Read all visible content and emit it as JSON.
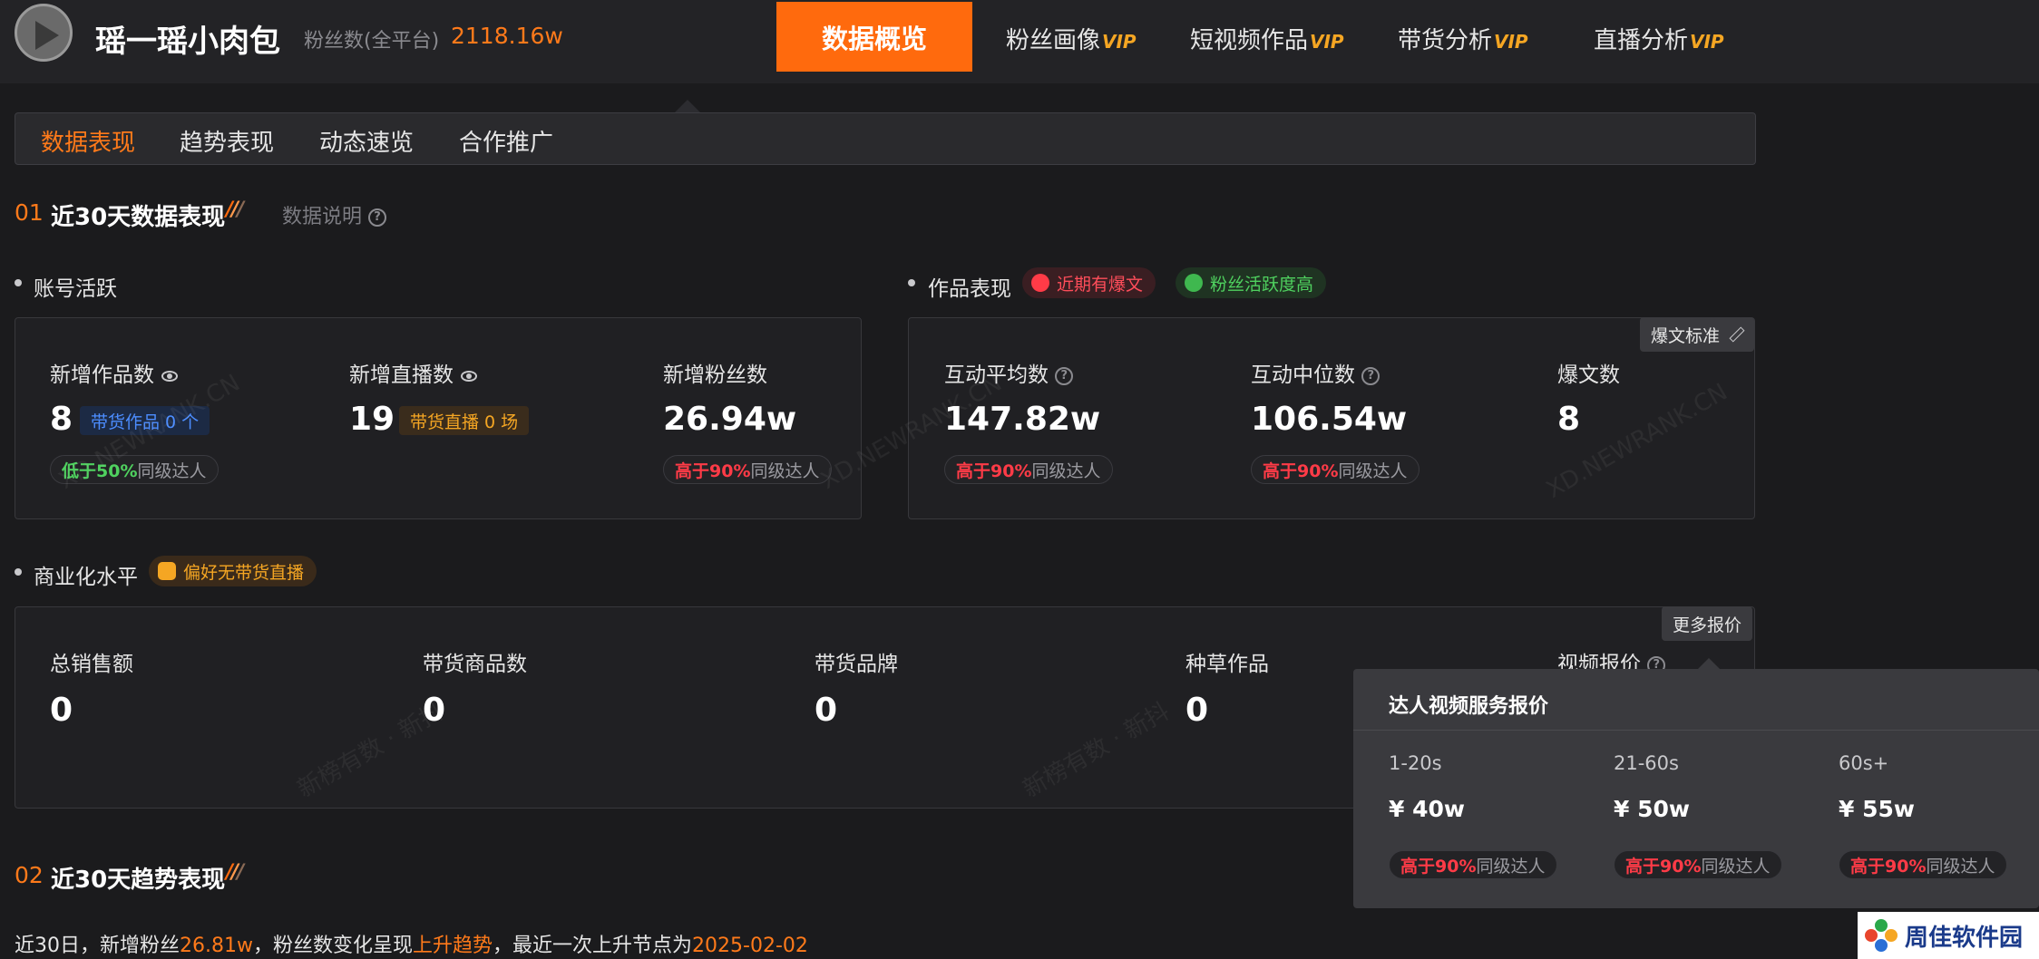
{
  "header": {
    "creator_name": "瑶一瑶小肉包",
    "fans_label": "粉丝数(全平台)",
    "fans_value": "2118.16w",
    "nav": {
      "active": "数据概览",
      "items": [
        {
          "label": "粉丝画像",
          "badge": "VIP"
        },
        {
          "label": "短视频作品",
          "badge": "VIP"
        },
        {
          "label": "带货分析",
          "badge": "VIP"
        },
        {
          "label": "直播分析",
          "badge": "VIP"
        }
      ]
    }
  },
  "subtabs": [
    "数据表现",
    "趋势表现",
    "动态速览",
    "合作推广"
  ],
  "section1": {
    "num": "01",
    "title": "近30天数据表现",
    "note": "数据说明",
    "account": {
      "title": "账号活跃",
      "metrics": [
        {
          "label": "新增作品数",
          "value": "8",
          "pill": "带货作品 0 个",
          "compare_prefix": "低于50%",
          "compare_suffix": "同级达人"
        },
        {
          "label": "新增直播数",
          "value": "19",
          "pill": "带货直播 0 场"
        },
        {
          "label": "新增粉丝数",
          "value": "26.94w",
          "compare_prefix": "高于90%",
          "compare_suffix": "同级达人"
        }
      ]
    },
    "works": {
      "title": "作品表现",
      "tag_hot": "近期有爆文",
      "tag_active": "粉丝活跃度高",
      "corner_btn": "爆文标准",
      "metrics": [
        {
          "label": "互动平均数",
          "value": "147.82w",
          "compare_prefix": "高于90%",
          "compare_suffix": "同级达人"
        },
        {
          "label": "互动中位数",
          "value": "106.54w",
          "compare_prefix": "高于90%",
          "compare_suffix": "同级达人"
        },
        {
          "label": "爆文数",
          "value": "8"
        }
      ]
    },
    "commerce": {
      "title": "商业化水平",
      "tag": "偏好无带货直播",
      "corner_btn": "更多报价",
      "metrics": [
        {
          "label": "总销售额",
          "value": "0"
        },
        {
          "label": "带货商品数",
          "value": "0"
        },
        {
          "label": "带货品牌",
          "value": "0"
        },
        {
          "label": "种草作品",
          "value": "0"
        },
        {
          "label": "视频报价"
        }
      ]
    }
  },
  "popup": {
    "title": "达人视频服务报价",
    "prices": [
      {
        "range": "1-20s",
        "value": "¥ 40w",
        "compare_prefix": "高于90%",
        "compare_suffix": "同级达人"
      },
      {
        "range": "21-60s",
        "value": "¥ 50w",
        "compare_prefix": "高于90%",
        "compare_suffix": "同级达人"
      },
      {
        "range": "60s+",
        "value": "¥ 55w",
        "compare_prefix": "高于90%",
        "compare_suffix": "同级达人"
      }
    ]
  },
  "section2": {
    "num": "02",
    "title": "近30天趋势表现",
    "summary": {
      "p1": "近30日，新增粉丝",
      "fans": "26.81w",
      "p2": "，粉丝数变化呈现",
      "trend": "上升趋势",
      "p3": "，最近一次上升节点为",
      "date": "2025-02-02"
    }
  },
  "watermarks": {
    "site": "XD.NEWRANK.CN",
    "brand": "新榜有数 · 新抖"
  },
  "logo": {
    "text": "周佳软件园"
  },
  "colors": {
    "accent": "#ff6a0d",
    "vip": "#f5a623",
    "hot": "#ff3b47",
    "good": "#4fd15f",
    "bg": "#1b1b1d"
  }
}
